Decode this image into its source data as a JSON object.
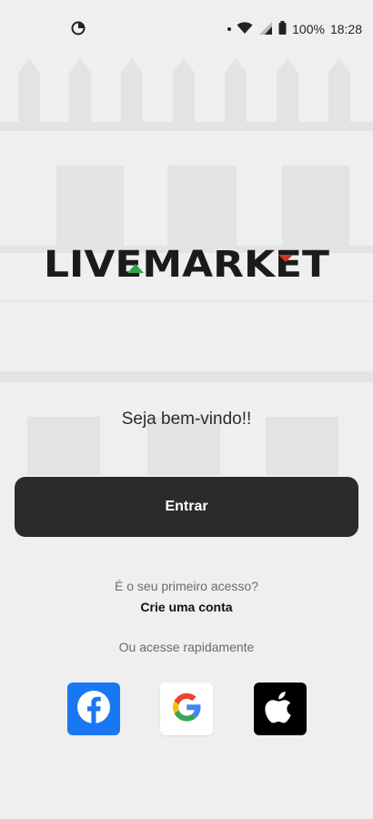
{
  "status_bar": {
    "battery": "100%",
    "time": "18:28"
  },
  "welcome": {
    "title": "Seja bem-vindo!!"
  },
  "actions": {
    "enter_label": "Entrar"
  },
  "signup": {
    "prompt": "É o seu primeiro acesso?",
    "link_label": "Crie uma conta"
  },
  "quick_access": {
    "label": "Ou acesse rapidamente"
  },
  "social_buttons": [
    {
      "icon": "facebook-icon",
      "color": "#1A77F2"
    },
    {
      "icon": "google-icon",
      "color": "#FFFFFF"
    },
    {
      "icon": "apple-icon",
      "color": "#000000"
    }
  ],
  "colors": {
    "primary_button": "#2B2B2B",
    "logo_green": "#2FA34A",
    "logo_red": "#D4312C",
    "background": "#EFEFEF"
  }
}
